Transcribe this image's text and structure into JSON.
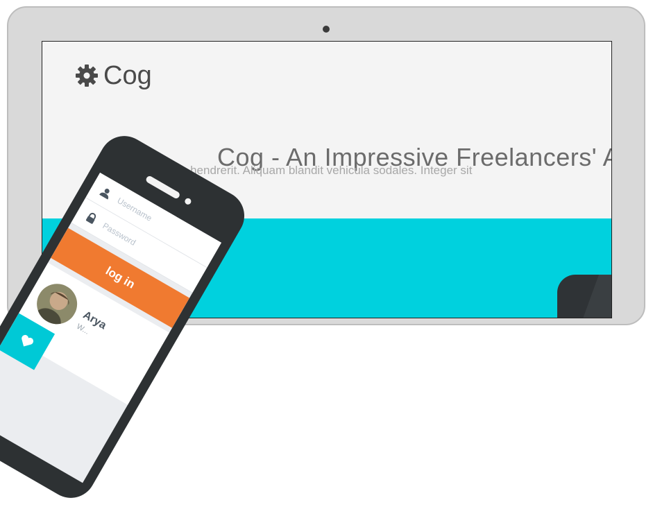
{
  "site": {
    "logo_text": "Cog",
    "hero_title": "Cog - An Impressive Freelancers' A",
    "hero_subtitle": "Nulla f... hendrerit. Aliquam blandit vehicula sodales. Integer sit"
  },
  "phone": {
    "username_placeholder": "Username",
    "password_placeholder": "Password",
    "login_label": "log in",
    "profile_name": "Arya",
    "profile_sub": "W..."
  },
  "colors": {
    "teal": "#00d1de",
    "orange": "#f07a30",
    "phone_body": "#2d3133"
  },
  "icons": {
    "logo": "gear-icon",
    "username": "user-icon",
    "password": "lock-icon",
    "like": "heart-icon"
  }
}
